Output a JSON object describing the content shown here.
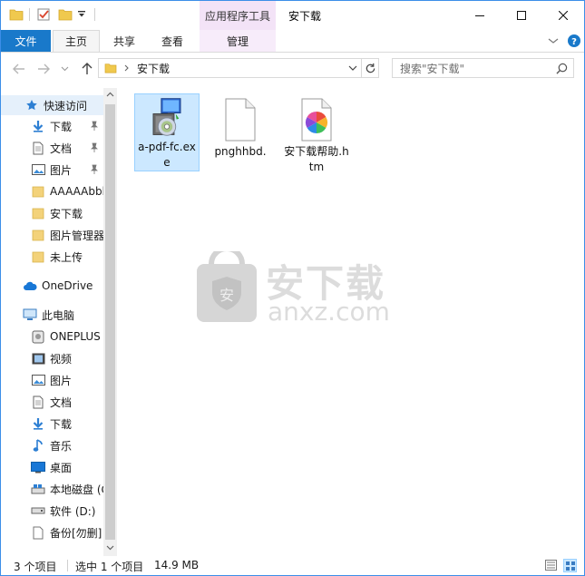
{
  "window": {
    "title": "安下载",
    "context_tab_header": "应用程序工具",
    "controls": {
      "minimize": "minimize-icon",
      "maximize": "maximize-icon",
      "close": "close-icon"
    }
  },
  "ribbon": {
    "tabs": [
      {
        "label": "文件"
      },
      {
        "label": "主页"
      },
      {
        "label": "共享"
      },
      {
        "label": "查看"
      },
      {
        "label": "管理"
      }
    ]
  },
  "address": {
    "path_segments": [
      "安下载"
    ],
    "search_placeholder": "搜索\"安下载\""
  },
  "sidebar": {
    "quick_access": {
      "label": "快速访问"
    },
    "quick_items": [
      {
        "label": "下载",
        "icon": "download-arrow-icon",
        "pinned": true
      },
      {
        "label": "文档",
        "icon": "document-icon",
        "pinned": true
      },
      {
        "label": "图片",
        "icon": "picture-icon",
        "pinned": true
      },
      {
        "label": "AAAAAbbbb",
        "icon": "folder-icon",
        "pinned": false
      },
      {
        "label": "安下载",
        "icon": "folder-icon",
        "pinned": false
      },
      {
        "label": "图片管理器",
        "icon": "folder-icon",
        "pinned": false
      },
      {
        "label": "未上传",
        "icon": "folder-icon",
        "pinned": false
      }
    ],
    "onedrive": {
      "label": "OneDrive"
    },
    "this_pc": {
      "label": "此电脑"
    },
    "pc_items": [
      {
        "label": "ONEPLUS",
        "icon": "phone-device-icon"
      },
      {
        "label": "视频",
        "icon": "video-icon"
      },
      {
        "label": "图片",
        "icon": "picture-icon"
      },
      {
        "label": "文档",
        "icon": "document-icon"
      },
      {
        "label": "下载",
        "icon": "download-arrow-icon"
      },
      {
        "label": "音乐",
        "icon": "music-note-icon"
      },
      {
        "label": "桌面",
        "icon": "desktop-icon"
      },
      {
        "label": "本地磁盘 (C:)",
        "icon": "drive-icon"
      },
      {
        "label": "软件 (D:)",
        "icon": "drive-icon"
      },
      {
        "label": "备份[勿删]",
        "icon": "file-icon"
      }
    ]
  },
  "files": [
    {
      "name": "a-pdf-fc.exe",
      "icon": "installer-exe-icon",
      "selected": true
    },
    {
      "name": "pnghhbd.",
      "icon": "blank-file-icon",
      "selected": false
    },
    {
      "name": "安下载帮助.htm",
      "icon": "htm-file-icon",
      "selected": false
    }
  ],
  "watermark": {
    "cn": "安下载",
    "en": "anxz.com",
    "shield_char": "安"
  },
  "status": {
    "item_count": "3 个项目",
    "selection": "选中 1 个项目",
    "size": "14.9 MB"
  }
}
